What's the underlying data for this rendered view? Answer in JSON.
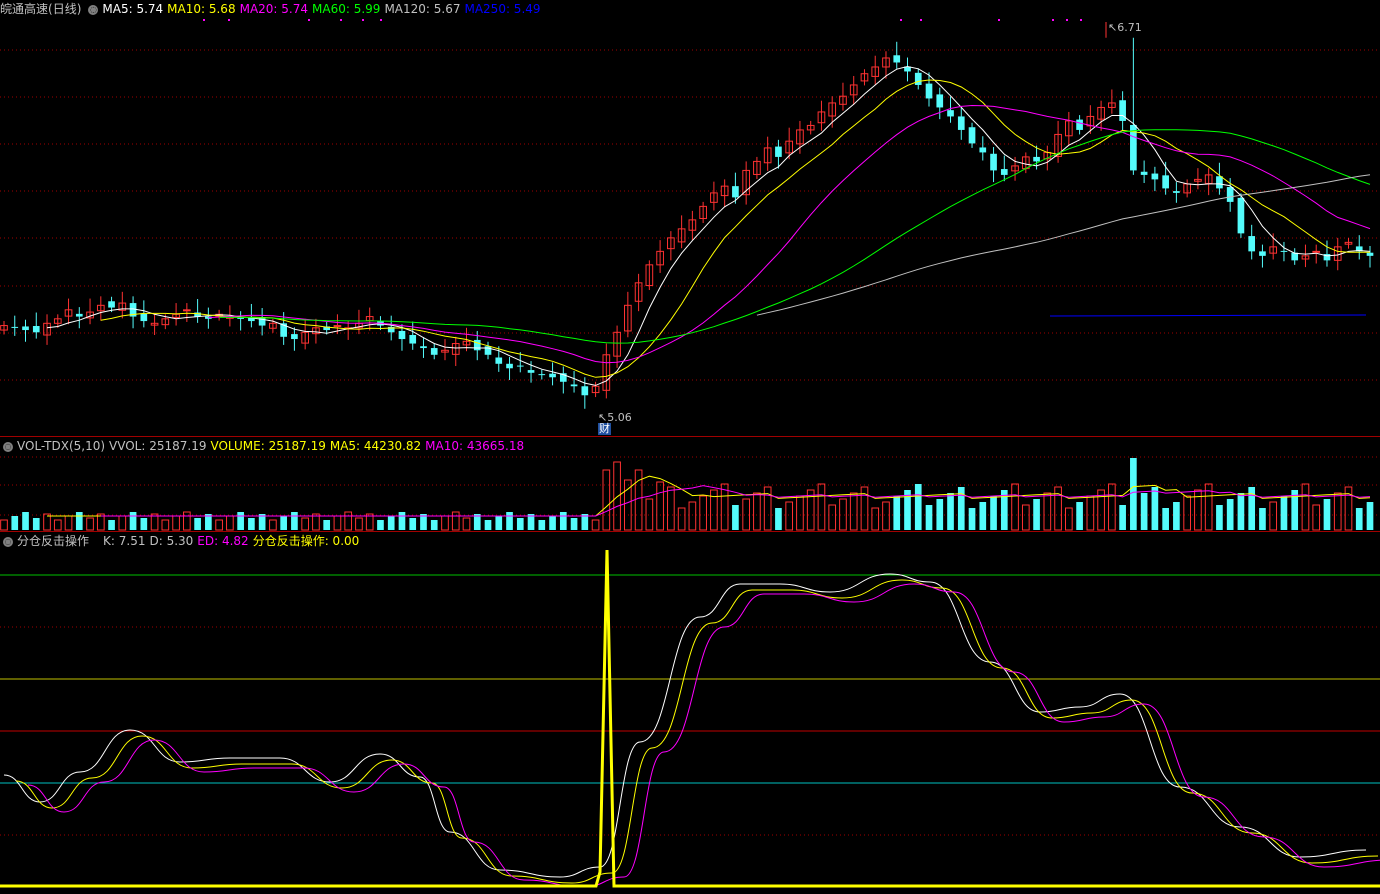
{
  "main_pane": {
    "stock_name": "皖通高速",
    "period": "(日线)",
    "ma": [
      {
        "label": "MA5: 5.74",
        "color": "#ffffff"
      },
      {
        "label": "MA10: 5.68",
        "color": "#ffff00"
      },
      {
        "label": "MA20: 5.74",
        "color": "#ff00ff"
      },
      {
        "label": "MA60: 5.99",
        "color": "#00ff00"
      },
      {
        "label": "MA120: 5.67",
        "color": "#c0c0c0"
      },
      {
        "label": "MA250: 5.49",
        "color": "#0000ff"
      }
    ],
    "high_label": "6.71",
    "low_label": "5.06",
    "event_badge": "财"
  },
  "volume_pane": {
    "name": "VOL-TDX(5,10)",
    "items": [
      {
        "label": "VVOL: 25187.19",
        "color": "#c0c0c0"
      },
      {
        "label": "VOLUME: 25187.19",
        "color": "#ffff00"
      },
      {
        "label": "MA5: 44230.82",
        "color": "#ffff00"
      },
      {
        "label": "MA10: 43665.18",
        "color": "#ff00ff"
      }
    ]
  },
  "indicator_pane": {
    "name": "分仓反击操作",
    "items": [
      {
        "label": "K: 7.51",
        "color": "#c0c0c0"
      },
      {
        "label": "D: 5.30",
        "color": "#c0c0c0"
      },
      {
        "label": "ED: 4.82",
        "color": "#ff00ff"
      },
      {
        "label": "分仓反击操作: 0.00",
        "color": "#ffff00"
      }
    ]
  },
  "colors": {
    "up": "#ff3232",
    "down": "#54fcfc",
    "ma5": "#ffffff",
    "ma10": "#ffff00",
    "ma20": "#ff00ff",
    "ma60": "#00ff00",
    "ma120": "#c0c0c0",
    "ma250": "#0000ff",
    "grid": "#a00000"
  },
  "chart_data": {
    "type": "candlestick",
    "y_high": 6.71,
    "y_low": 5.06,
    "closes": [
      5.43,
      5.42,
      5.41,
      5.4,
      5.44,
      5.46,
      5.5,
      5.47,
      5.49,
      5.52,
      5.51,
      5.53,
      5.47,
      5.45,
      5.44,
      5.46,
      5.48,
      5.5,
      5.47,
      5.46,
      5.48,
      5.47,
      5.46,
      5.45,
      5.43,
      5.44,
      5.38,
      5.37,
      5.4,
      5.42,
      5.41,
      5.43,
      5.42,
      5.44,
      5.47,
      5.43,
      5.4,
      5.37,
      5.35,
      5.33,
      5.3,
      5.32,
      5.35,
      5.36,
      5.32,
      5.3,
      5.26,
      5.24,
      5.25,
      5.22,
      5.21,
      5.2,
      5.18,
      5.16,
      5.12,
      5.16,
      5.3,
      5.4,
      5.52,
      5.62,
      5.7,
      5.76,
      5.82,
      5.86,
      5.9,
      5.96,
      6.02,
      6.05,
      6.0,
      6.12,
      6.16,
      6.22,
      6.18,
      6.25,
      6.3,
      6.32,
      6.38,
      6.42,
      6.45,
      6.5,
      6.55,
      6.58,
      6.62,
      6.6,
      6.56,
      6.5,
      6.44,
      6.4,
      6.36,
      6.3,
      6.24,
      6.2,
      6.12,
      6.1,
      6.14,
      6.18,
      6.16,
      6.2,
      6.28,
      6.34,
      6.3,
      6.36,
      6.4,
      6.42,
      6.34,
      6.12,
      6.1,
      6.08,
      6.04,
      6.02,
      6.06,
      6.08,
      6.1,
      6.04,
      5.98,
      5.84,
      5.76,
      5.74,
      5.78,
      5.76,
      5.72,
      5.74,
      5.76,
      5.72,
      5.78,
      5.8,
      5.76,
      5.74
    ]
  }
}
